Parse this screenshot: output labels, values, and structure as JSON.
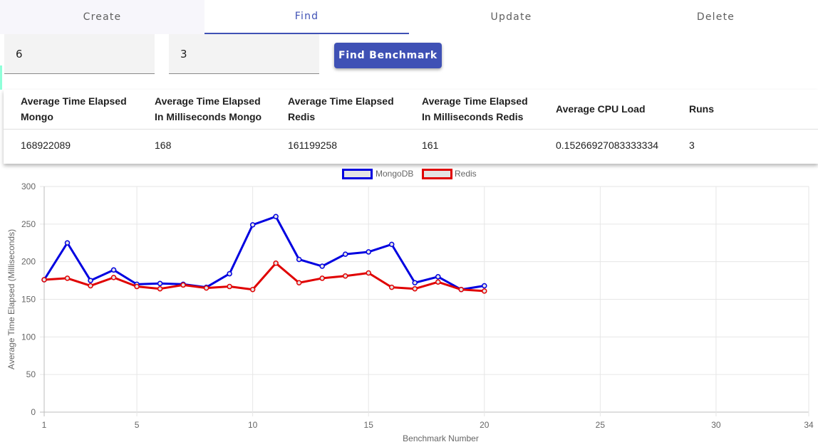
{
  "tabs": [
    {
      "label": "Create"
    },
    {
      "label": "Find"
    },
    {
      "label": "Update"
    },
    {
      "label": "Delete"
    }
  ],
  "form": {
    "field_1_value": "6",
    "field_2_value": "3",
    "button_label": "Find Benchmark"
  },
  "table": {
    "headers": [
      [
        "Average Time Elapsed",
        "Mongo"
      ],
      [
        "Average Time Elapsed",
        "In Milliseconds Mongo"
      ],
      [
        "Average Time Elapsed",
        "Redis"
      ],
      [
        "Average Time Elapsed",
        "In Milliseconds Redis"
      ],
      [
        "Average CPU Load"
      ],
      [
        "Runs"
      ]
    ],
    "row": [
      "168922089",
      "168",
      "161199258",
      "161",
      "0.15266927083333334",
      "3"
    ]
  },
  "chart_data": {
    "type": "line",
    "xlabel": "Benchmark Number",
    "ylabel": "Average Time Elapsed (Milliseconds)",
    "xlim": [
      1,
      34
    ],
    "ylim": [
      0,
      300
    ],
    "xticks": [
      1,
      5,
      10,
      15,
      20,
      25,
      30,
      34
    ],
    "yticks": [
      0,
      50,
      100,
      150,
      200,
      250,
      300
    ],
    "grid": true,
    "legend_position": "top-center",
    "series": [
      {
        "name": "MongoDB",
        "color": "#0000e0",
        "x": [
          1,
          2,
          3,
          4,
          5,
          6,
          7,
          8,
          9,
          10,
          11,
          12,
          13,
          14,
          15,
          16,
          17,
          18,
          19,
          20
        ],
        "values": [
          176,
          225,
          175,
          189,
          170,
          171,
          170,
          166,
          184,
          249,
          260,
          203,
          194,
          210,
          213,
          223,
          172,
          180,
          163,
          168
        ]
      },
      {
        "name": "Redis",
        "color": "#e00000",
        "x": [
          1,
          2,
          3,
          4,
          5,
          6,
          7,
          8,
          9,
          10,
          11,
          12,
          13,
          14,
          15,
          16,
          17,
          18,
          19,
          20
        ],
        "values": [
          176,
          178,
          168,
          179,
          167,
          164,
          169,
          165,
          167,
          163,
          198,
          172,
          178,
          181,
          185,
          166,
          164,
          173,
          163,
          161
        ]
      }
    ]
  }
}
